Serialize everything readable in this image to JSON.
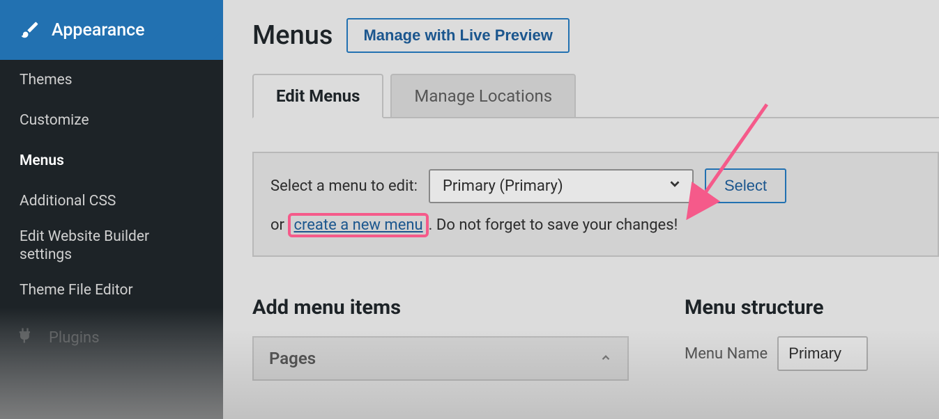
{
  "sidebar": {
    "active_label": "Appearance",
    "items": [
      "Themes",
      "Customize",
      "Menus",
      "Additional CSS",
      "Edit Website Builder settings",
      "Theme File Editor"
    ],
    "current_index": 2,
    "plugins": "Plugins"
  },
  "header": {
    "title": "Menus",
    "preview_btn": "Manage with Live Preview"
  },
  "tabs": {
    "items": [
      "Edit Menus",
      "Manage Locations"
    ],
    "active_index": 0
  },
  "select_panel": {
    "label": "Select a menu to edit:",
    "dropdown_value": "Primary (Primary)",
    "select_btn": "Select",
    "or_text": "or ",
    "create_link": "create a new menu",
    "after_text": ". Do not forget to save your changes!"
  },
  "columns": {
    "add_title": "Add menu items",
    "pages_label": "Pages",
    "structure_title": "Menu structure",
    "menu_name_label": "Menu Name",
    "menu_name_value": "Primary"
  }
}
